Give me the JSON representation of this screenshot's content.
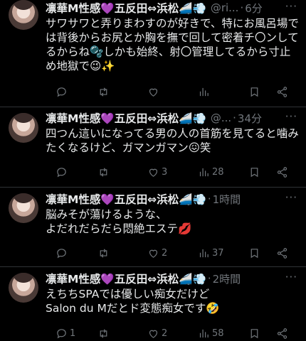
{
  "colors": {
    "background": "#000000",
    "text": "#e7e9ea",
    "muted": "#71767b",
    "separator": "#2f3336"
  },
  "tweets": [
    {
      "name": "凛華M性感💜五反田⇔浜松🚄💨",
      "handle": "@ri...",
      "dot": "·",
      "time": "6分",
      "more": "···",
      "text": "サワサワと弄りまわすのが好きで、特にお風呂場では背後からお尻とか胸を撫で回して密着チ〇ンしてるからね🫧しかも始終、射〇管理してるから寸止め地獄で😉✨",
      "counts": {
        "reply": "",
        "retweet": "",
        "like": "",
        "views": ""
      }
    },
    {
      "name": "凛華M性感💜五反田⇔浜松🚄💨",
      "handle": "@...",
      "dot": "·",
      "time": "34分",
      "more": "···",
      "text": "四つん這いになってる男の人の首筋を見てると噛みたくなるけど、ガマンガマン😖笑",
      "counts": {
        "reply": "",
        "retweet": "",
        "like": "3",
        "views": "28"
      }
    },
    {
      "name": "凛華M性感💜五反田⇔浜松🚄💨",
      "handle": "",
      "dot": "·",
      "time": "1時間",
      "more": "···",
      "text": "脳みそが蕩けるような、\nよだれだらだら悶絶エステ💋",
      "counts": {
        "reply": "",
        "retweet": "",
        "like": "2",
        "views": "37"
      }
    },
    {
      "name": "凛華M性感💜五反田⇔浜松🚄💨",
      "handle": "",
      "dot": "·",
      "time": "2時間",
      "more": "···",
      "text": "えちちSPAでは優しい痴女だけど\nSalon du Mだとド変態痴女です🤣",
      "counts": {
        "reply": "1",
        "retweet": "",
        "like": "2",
        "views": "58"
      }
    }
  ],
  "icons": {
    "reply": "reply-icon",
    "retweet": "retweet-icon",
    "like": "heart-icon",
    "views": "views-icon",
    "bookmark": "bookmark-icon",
    "share": "share-icon"
  }
}
